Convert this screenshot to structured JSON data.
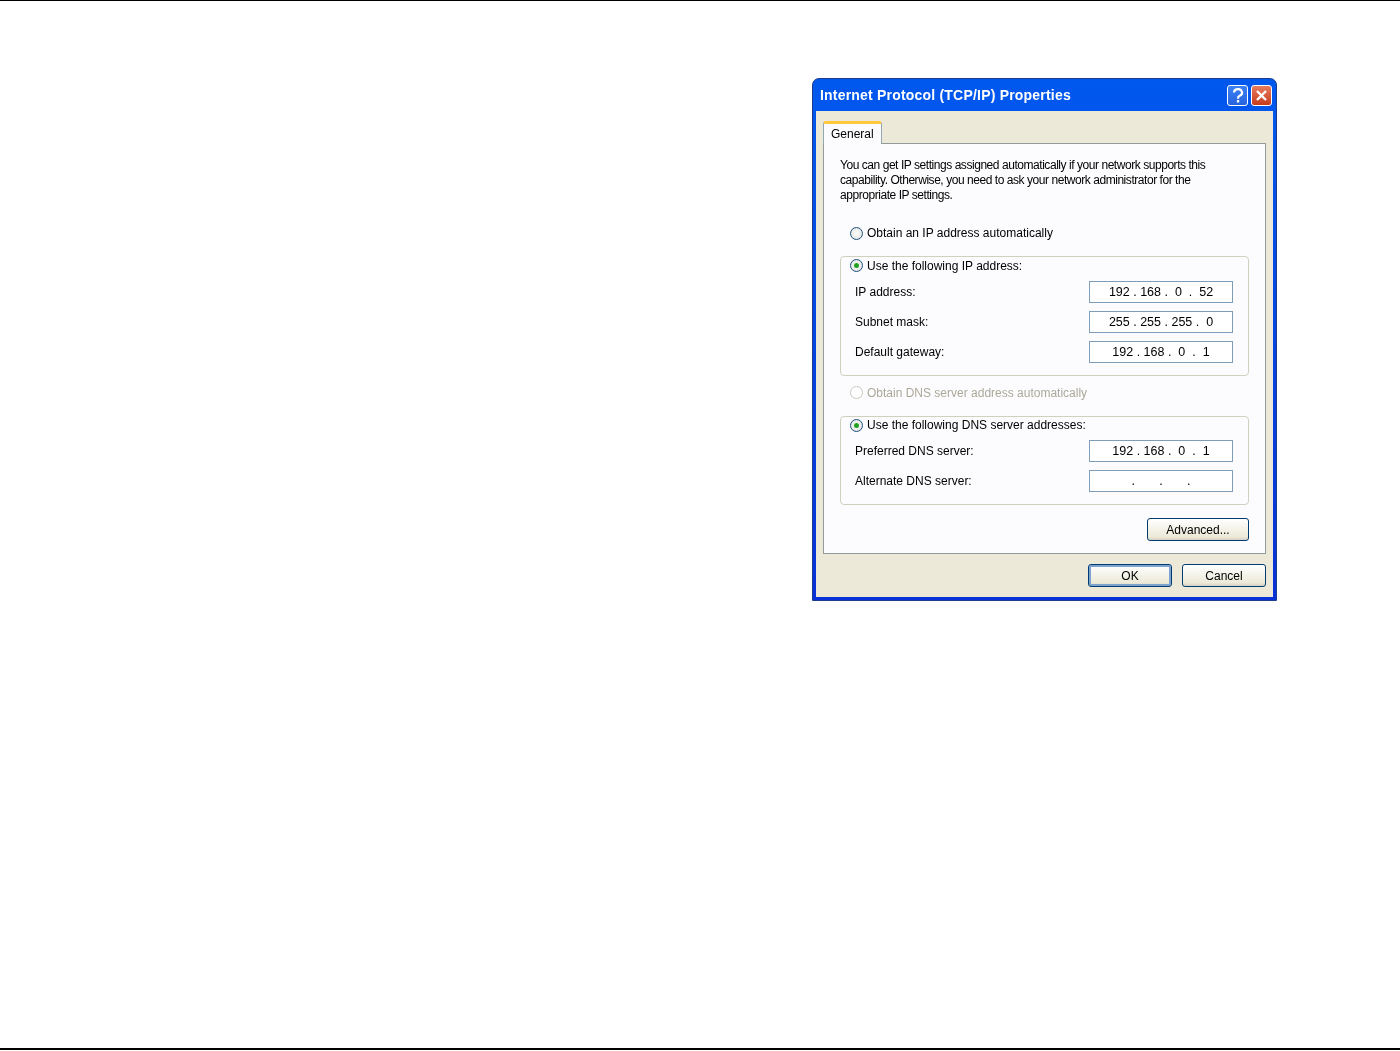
{
  "window": {
    "title": "Internet Protocol (TCP/IP) Properties"
  },
  "tabs": [
    {
      "label": "General",
      "selected": true
    }
  ],
  "intro": "You can get IP settings assigned automatically if your network supports this capability. Otherwise, you need to ask your network administrator for the appropriate IP settings.",
  "ip": {
    "auto_option": {
      "label": "Obtain an IP address automatically",
      "selected": false,
      "disabled": false
    },
    "manual_option": {
      "label": "Use the following IP address:",
      "selected": true,
      "disabled": false
    },
    "fields": [
      {
        "label": "IP address:",
        "value": "192 . 168 .  0  .  52"
      },
      {
        "label": "Subnet mask:",
        "value": "255 . 255 . 255 .  0"
      },
      {
        "label": "Default gateway:",
        "value": "192 . 168 .  0  .  1"
      }
    ]
  },
  "dns": {
    "auto_option": {
      "label": "Obtain DNS server address automatically",
      "selected": false,
      "disabled": true
    },
    "manual_option": {
      "label": "Use the following DNS server addresses:",
      "selected": true,
      "disabled": false
    },
    "fields": [
      {
        "label": "Preferred DNS server:",
        "value": "192 . 168 .  0  .  1"
      },
      {
        "label": "Alternate DNS server:",
        "value": ".       .       ."
      }
    ]
  },
  "advanced_button": "Advanced...",
  "buttons": [
    {
      "label": "OK",
      "default": true
    },
    {
      "label": "Cancel",
      "default": false
    }
  ]
}
